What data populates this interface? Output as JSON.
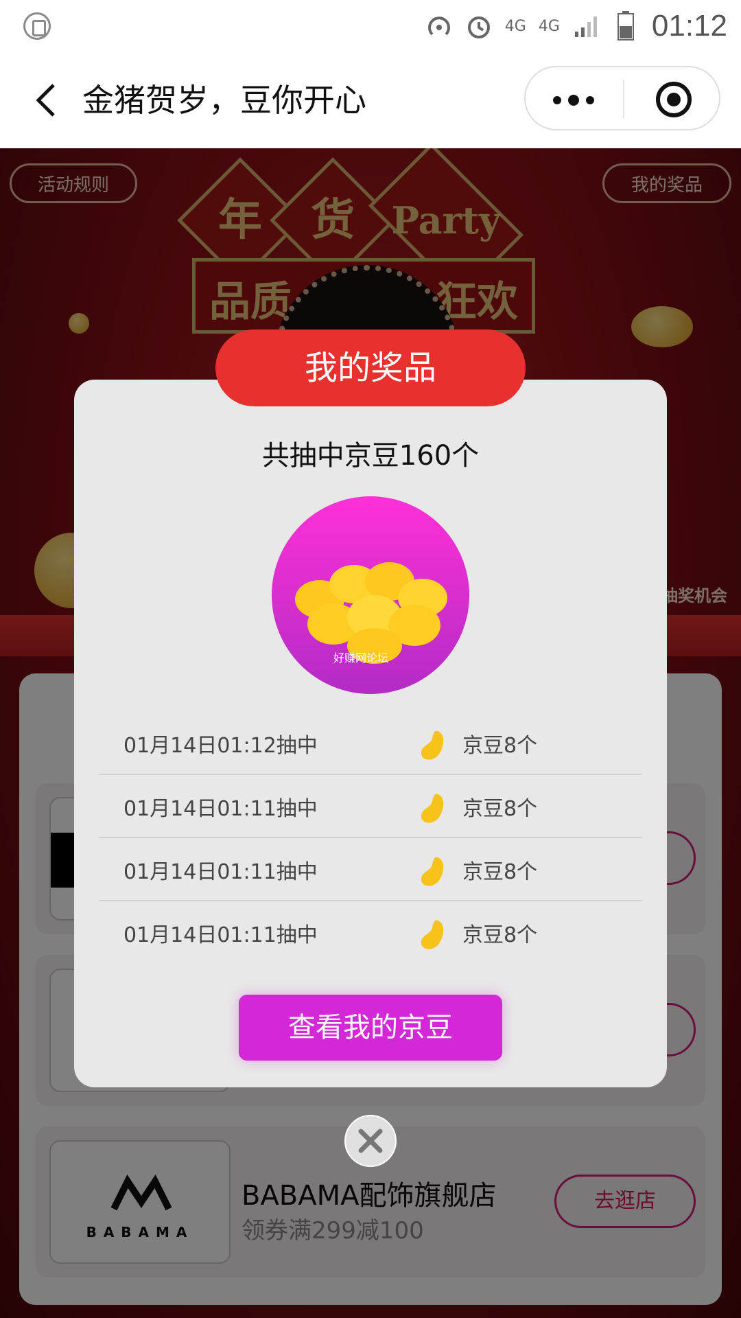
{
  "status_bar": {
    "network_top": "4G",
    "network_main": "4G",
    "time": "01:12"
  },
  "nav": {
    "title": "金猪贺岁，豆你开心"
  },
  "page": {
    "rules_button": "活动规则",
    "my_prizes_button": "我的奖品",
    "banner_chars": [
      "年",
      "货",
      "Party"
    ],
    "banner_sub_left": "品质",
    "banner_sub_right": "狂欢",
    "side_text": "的抽奖机会",
    "stores": [
      {
        "name": "",
        "coupon": "",
        "button": ""
      },
      {
        "name": "",
        "coupon": "",
        "button": ""
      },
      {
        "name": "BABAMA配饰旗舰店",
        "coupon": "领券满299减100",
        "button": "去逛店",
        "logo_text": "BABAMA"
      }
    ]
  },
  "modal": {
    "title": "我的奖品",
    "summary": "共抽中京豆160个",
    "watermark": "好赚网论坛",
    "records": [
      {
        "time": "01月14日01:12抽中",
        "prize": "京豆8个"
      },
      {
        "time": "01月14日01:11抽中",
        "prize": "京豆8个"
      },
      {
        "time": "01月14日01:11抽中",
        "prize": "京豆8个"
      },
      {
        "time": "01月14日01:11抽中",
        "prize": "京豆8个"
      }
    ],
    "action_button": "查看我的京豆"
  },
  "colors": {
    "header_red": "#e8302e",
    "button_purple": "#d427d8",
    "bean_yellow": "#f7c21a"
  }
}
